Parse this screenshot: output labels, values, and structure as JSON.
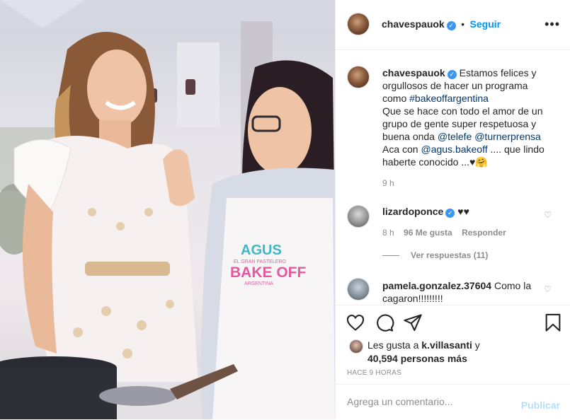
{
  "photo": {
    "apron_line1": "AGUS",
    "apron_line2": "EL GRAN PASTELERO",
    "apron_line3": "BAKE OFF",
    "apron_line4": "ARGENTINA"
  },
  "header": {
    "username": "chavespauok",
    "separator": "•",
    "follow_label": "Seguir",
    "more_label": "•••"
  },
  "caption": {
    "username": "chavespauok",
    "text_1": "Estamos felices y orgullosos de hacer un programa como",
    "hashtag": "#bakeoffargentina",
    "text_2": "Que se hace con todo el amor de un grupo de gente super respetuosa y buena onda",
    "mention_1": "@telefe",
    "mention_2": "@turnerprensa",
    "text_3": "Aca con",
    "mention_3": "@agus.bakeoff",
    "text_4": ".... que lindo haberte conocido ...♥🤗",
    "time": "9 h"
  },
  "comments": [
    {
      "username": "lizardoponce",
      "text": "♥♥",
      "time": "8 h",
      "likes": "96 Me gusta",
      "reply_label": "Responder",
      "view_replies": "Ver respuestas (11)"
    },
    {
      "username": "pamela.gonzalez.37604",
      "text": "Como la cagaron!!!!!!!!!"
    }
  ],
  "likes": {
    "prefix": "Les gusta a",
    "user": "k.villasanti",
    "conj": "y",
    "count": "40,594 personas más"
  },
  "timestamp": "HACE 9 HORAS",
  "add_comment": {
    "placeholder": "Agrega un comentario...",
    "post_label": "Publicar"
  },
  "colors": {
    "accent": "#0095f6",
    "verified": "#3897f0",
    "post_disabled": "#b2dffc",
    "link": "#00376b",
    "muted": "#8e8e8e"
  }
}
